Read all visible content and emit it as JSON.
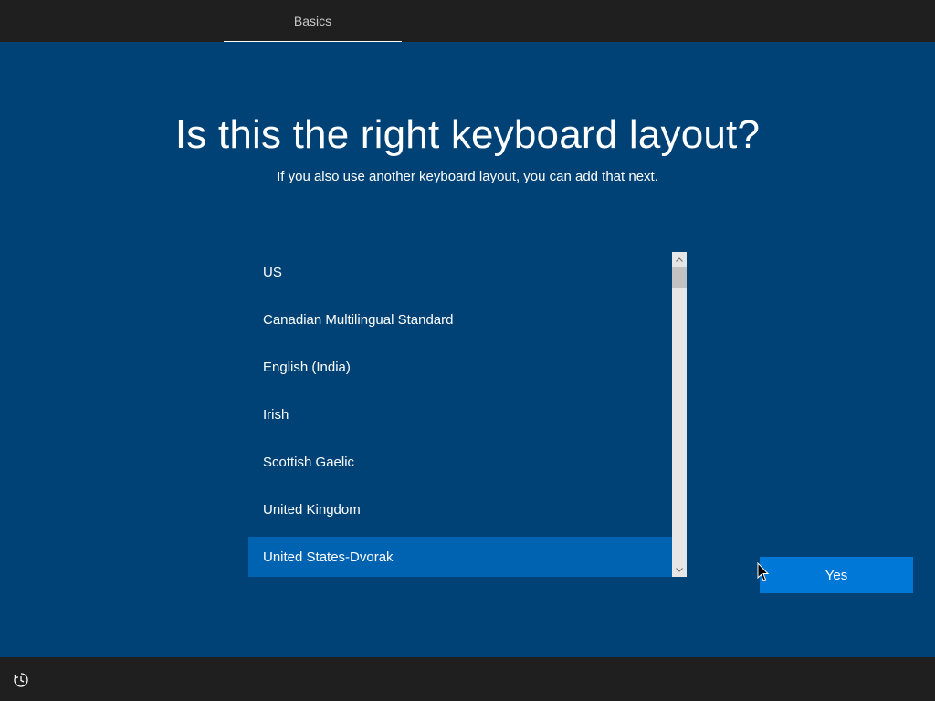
{
  "header": {
    "tabs": [
      {
        "label": "Basics",
        "active": true
      }
    ]
  },
  "main": {
    "title": "Is this the right keyboard layout?",
    "subtitle": "If you also use another keyboard layout, you can add that next.",
    "layouts": [
      "US",
      "Canadian Multilingual Standard",
      "English (India)",
      "Irish",
      "Scottish Gaelic",
      "United Kingdom",
      "United States-Dvorak"
    ],
    "selected_layout": "United States-Dvorak",
    "yes_label": "Yes"
  },
  "footer": {
    "accessibility_icon": "ease-of-access-icon"
  },
  "colors": {
    "background": "#004275",
    "bar": "#1f1f1f",
    "selected": "#0063b1",
    "button": "#0078d7"
  }
}
